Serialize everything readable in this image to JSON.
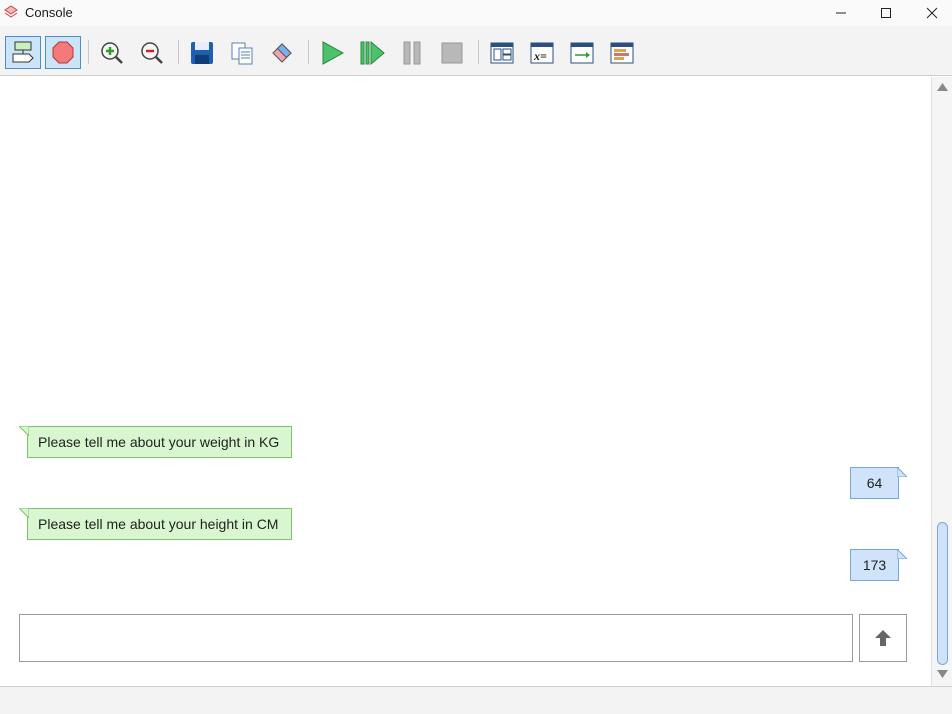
{
  "window": {
    "title": "Console"
  },
  "toolbar": {
    "buttons": [
      {
        "name": "toggle-flow-icon",
        "active": true
      },
      {
        "name": "stop-sign-icon",
        "active": true
      },
      {
        "name": "zoom-in-icon",
        "active": false
      },
      {
        "name": "zoom-out-icon",
        "active": false
      },
      {
        "name": "save-icon",
        "active": false
      },
      {
        "name": "copy-icon",
        "active": false
      },
      {
        "name": "eraser-icon",
        "active": false
      },
      {
        "name": "run-icon",
        "active": false
      },
      {
        "name": "step-icon",
        "active": false
      },
      {
        "name": "pause-icon",
        "active": false
      },
      {
        "name": "stop-icon",
        "active": false
      },
      {
        "name": "layout-icon",
        "active": false
      },
      {
        "name": "variables-icon",
        "active": false
      },
      {
        "name": "output-icon",
        "active": false
      },
      {
        "name": "list-icon",
        "active": false
      }
    ]
  },
  "chat": {
    "messages": [
      {
        "side": "left",
        "text": "Please tell me about your weight in KG"
      },
      {
        "side": "right",
        "text": "64"
      },
      {
        "side": "left",
        "text": "Please tell me about your height in CM"
      },
      {
        "side": "right",
        "text": "173"
      }
    ],
    "input_value": "",
    "send_icon": "up-arrow-icon"
  },
  "colors": {
    "prompt_bubble": "#d8f7d0",
    "answer_bubble": "#cfe3fb",
    "active_button": "#cce4f7"
  }
}
